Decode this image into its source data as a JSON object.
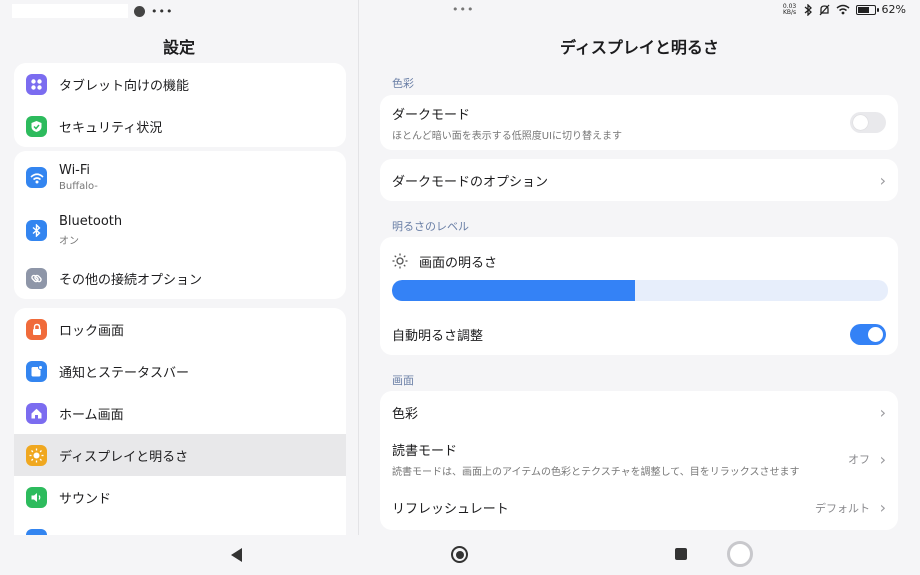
{
  "status_bar": {
    "battery": "62%",
    "net_speed_top": "0.03",
    "net_speed_bottom": "KB/s",
    "more_dots": "•••",
    "left_more": "•••"
  },
  "left": {
    "title": "設定",
    "groups": [
      {
        "items": [
          {
            "label": "タブレット向けの機能",
            "icon": "grid-icon",
            "color": "#7b6cf0"
          },
          {
            "label": "セキュリティ状況",
            "icon": "shield-check-icon",
            "color": "#2dbb5d"
          }
        ]
      },
      {
        "items": [
          {
            "label": "Wi-Fi",
            "sub": "Buffalo-",
            "icon": "wifi-icon",
            "color": "#3385f0"
          },
          {
            "label": "Bluetooth",
            "sub": "オン",
            "icon": "bluetooth-icon",
            "color": "#3385f0"
          },
          {
            "label": "その他の接続オプション",
            "icon": "link-icon",
            "color": "#8e96a8"
          }
        ]
      },
      {
        "items": [
          {
            "label": "ロック画面",
            "icon": "lock-icon",
            "color": "#f06b3b"
          },
          {
            "label": "通知とステータスバー",
            "icon": "notification-icon",
            "color": "#3385f0"
          },
          {
            "label": "ホーム画面",
            "icon": "home-icon",
            "color": "#7b6cf0"
          },
          {
            "label": "ディスプレイと明るさ",
            "icon": "sun-icon",
            "color": "#f0a820",
            "selected": true
          },
          {
            "label": "サウンド",
            "icon": "speaker-icon",
            "color": "#2dbb5d"
          }
        ]
      }
    ]
  },
  "right": {
    "title": "ディスプレイと明るさ",
    "sections": {
      "color": "色彩",
      "brightness": "明るさのレベル",
      "screen": "画面"
    },
    "dark_mode": {
      "label": "ダークモード",
      "sub": "ほとんど暗い面を表示する低照度UIに切り替えます",
      "enabled": false
    },
    "dark_mode_options": "ダークモードのオプション",
    "brightness": {
      "label": "画面の明るさ",
      "level_fraction": 0.49
    },
    "auto_brightness": {
      "label": "自動明るさ調整",
      "enabled": true
    },
    "screen_items": {
      "color": "色彩",
      "reading_mode": {
        "label": "読書モード",
        "sub": "読書モードは、画面上のアイテムの色彩とテクスチャを調整して、目をリラックスさせます",
        "value": "オフ"
      },
      "refresh_rate": {
        "label": "リフレッシュレート",
        "value": "デフォルト"
      }
    }
  },
  "colors": {
    "accent": "#3482f6",
    "section_label": "#6a7fa6",
    "selected_row": "#e8e8ea"
  }
}
